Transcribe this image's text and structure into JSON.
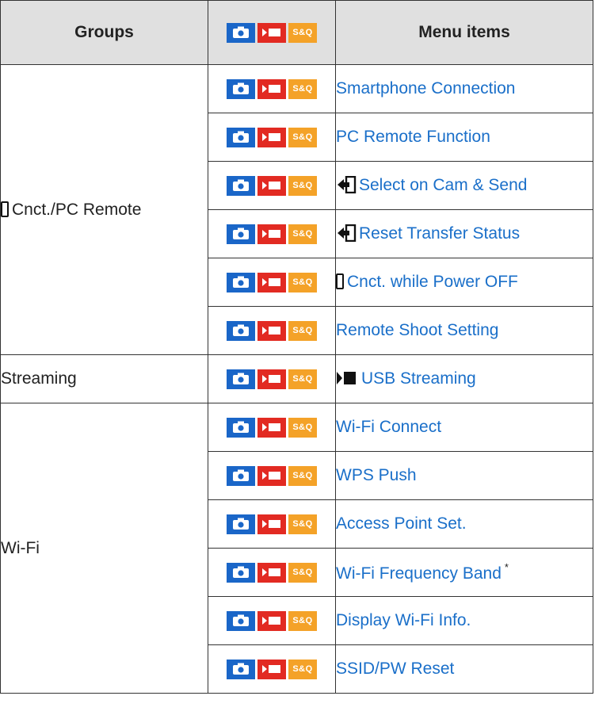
{
  "table": {
    "headers": {
      "groups": "Groups",
      "icons": "mode-icons",
      "menu_items": "Menu items"
    },
    "mode_badges": {
      "photo": "camera-icon",
      "movie": "movie-icon",
      "sq": "S&Q"
    },
    "groups": [
      {
        "label": "Cnct./PC Remote",
        "icon": "smartphone-icon",
        "items": [
          {
            "label": "Smartphone Connection"
          },
          {
            "label": "PC Remote Function"
          },
          {
            "label": "Select on Cam & Send",
            "icon": "send-icon"
          },
          {
            "label": "Reset Transfer Status",
            "icon": "send-icon"
          },
          {
            "label": "Cnct. while Power OFF",
            "icon": "smartphone-icon"
          },
          {
            "label": "Remote Shoot Setting"
          }
        ]
      },
      {
        "label": "Streaming",
        "items": [
          {
            "label": "USB Streaming",
            "icon": "streaming-icon"
          }
        ]
      },
      {
        "label": "Wi-Fi",
        "items": [
          {
            "label": "Wi-Fi Connect"
          },
          {
            "label": "WPS Push"
          },
          {
            "label": "Access Point Set."
          },
          {
            "label": "Wi-Fi Frequency Band",
            "footnote": "*"
          },
          {
            "label": "Display Wi-Fi Info."
          },
          {
            "label": "SSID/PW Reset"
          }
        ]
      }
    ],
    "colors": {
      "link": "#1a6fc9",
      "photo": "#1a66c8",
      "movie": "#e22a22",
      "sq": "#f4a228",
      "header_bg": "#e0e0e0"
    }
  }
}
